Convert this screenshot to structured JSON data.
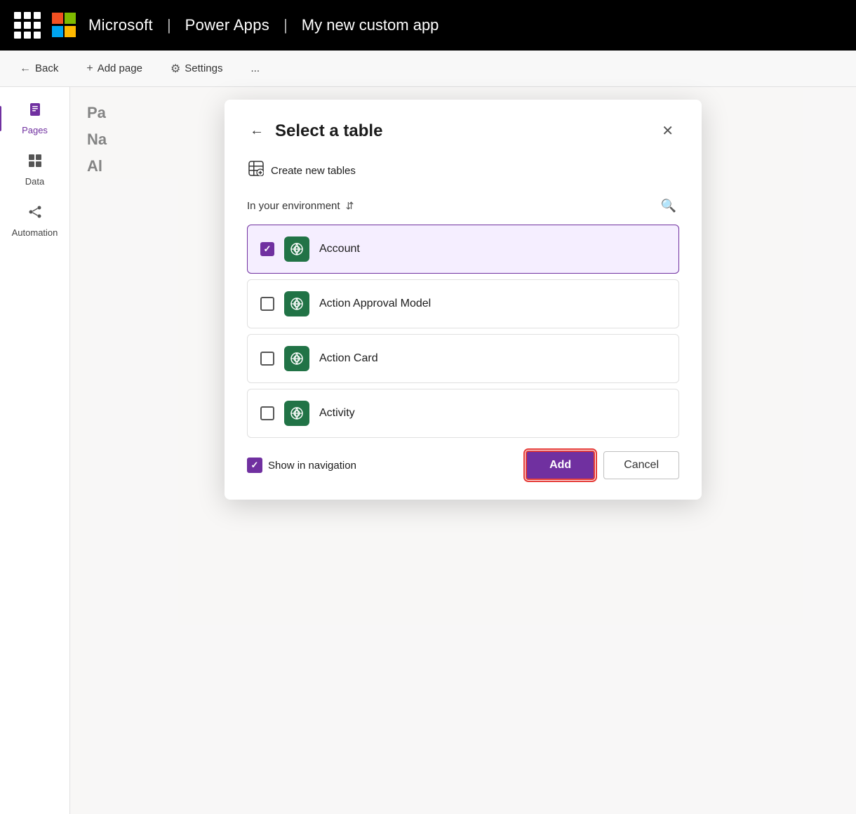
{
  "topbar": {
    "product": "Power Apps",
    "divider": "|",
    "app_name": "My new custom app"
  },
  "toolbar": {
    "back_label": "Back",
    "add_page_label": "Add page",
    "settings_label": "Settings",
    "more_label": "..."
  },
  "sidebar": {
    "items": [
      {
        "id": "pages",
        "label": "Pages",
        "icon": "📄",
        "active": true
      },
      {
        "id": "data",
        "label": "Data",
        "icon": "⊞",
        "active": false
      },
      {
        "id": "automation",
        "label": "Automation",
        "icon": "⚙",
        "active": false
      }
    ]
  },
  "content": {
    "page_title": "Pa",
    "name_label": "Na",
    "all_label": "Al"
  },
  "dialog": {
    "title": "Select a table",
    "create_new_label": "Create new tables",
    "environment_label": "In your environment",
    "tables": [
      {
        "id": "account",
        "name": "Account",
        "checked": true
      },
      {
        "id": "action-approval-model",
        "name": "Action Approval Model",
        "checked": false
      },
      {
        "id": "action-card",
        "name": "Action Card",
        "checked": false
      },
      {
        "id": "activity",
        "name": "Activity",
        "checked": false
      }
    ],
    "show_in_navigation_label": "Show in navigation",
    "show_in_navigation_checked": true,
    "add_button_label": "Add",
    "cancel_button_label": "Cancel"
  }
}
